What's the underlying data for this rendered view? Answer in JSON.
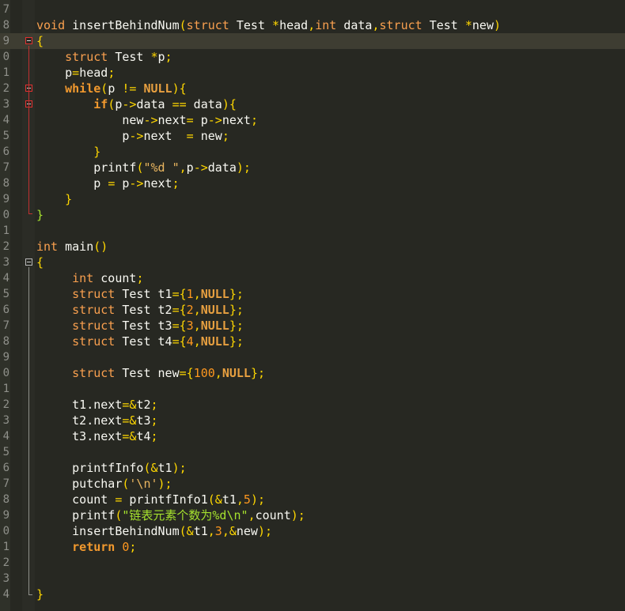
{
  "editor": {
    "theme_colors": {
      "background": "#272822",
      "current_line": "#3e3d32",
      "line_number": "#8f908a"
    },
    "lines": [
      {
        "num": "7",
        "segments": []
      },
      {
        "num": "8",
        "segments": [
          {
            "t": "void",
            "c": "kw"
          },
          {
            "t": " insertBehindNum",
            "c": "plain"
          },
          {
            "t": "(",
            "c": "br"
          },
          {
            "t": "struct",
            "c": "kw"
          },
          {
            "t": " Test ",
            "c": "plain"
          },
          {
            "t": "*",
            "c": "br"
          },
          {
            "t": "head",
            "c": "plain"
          },
          {
            "t": ",",
            "c": "br"
          },
          {
            "t": "int",
            "c": "kw"
          },
          {
            "t": " data",
            "c": "plain"
          },
          {
            "t": ",",
            "c": "br"
          },
          {
            "t": "struct",
            "c": "kw"
          },
          {
            "t": " Test ",
            "c": "plain"
          },
          {
            "t": "*",
            "c": "br"
          },
          {
            "t": "new",
            "c": "plain"
          },
          {
            "t": ")",
            "c": "br"
          }
        ]
      },
      {
        "num": "9",
        "current": true,
        "fold": "red",
        "segments": [
          {
            "t": "{",
            "c": "br"
          }
        ]
      },
      {
        "num": "0",
        "segments": [
          {
            "t": "    ",
            "c": "plain"
          },
          {
            "t": "struct",
            "c": "kw"
          },
          {
            "t": " Test ",
            "c": "plain"
          },
          {
            "t": "*",
            "c": "br"
          },
          {
            "t": "p",
            "c": "plain"
          },
          {
            "t": ";",
            "c": "br"
          }
        ]
      },
      {
        "num": "1",
        "segments": [
          {
            "t": "    p",
            "c": "plain"
          },
          {
            "t": "=",
            "c": "br"
          },
          {
            "t": "head",
            "c": "plain"
          },
          {
            "t": ";",
            "c": "br"
          }
        ]
      },
      {
        "num": "2",
        "fold": "red",
        "segments": [
          {
            "t": "    ",
            "c": "plain"
          },
          {
            "t": "while",
            "c": "kwb"
          },
          {
            "t": "(",
            "c": "br"
          },
          {
            "t": "p ",
            "c": "plain"
          },
          {
            "t": "!=",
            "c": "br"
          },
          {
            "t": " ",
            "c": "plain"
          },
          {
            "t": "NULL",
            "c": "lit"
          },
          {
            "t": "){",
            "c": "br"
          }
        ]
      },
      {
        "num": "3",
        "fold": "red",
        "segments": [
          {
            "t": "        ",
            "c": "plain"
          },
          {
            "t": "if",
            "c": "kwb"
          },
          {
            "t": "(",
            "c": "br"
          },
          {
            "t": "p",
            "c": "plain"
          },
          {
            "t": "->",
            "c": "br"
          },
          {
            "t": "data ",
            "c": "plain"
          },
          {
            "t": "==",
            "c": "br"
          },
          {
            "t": " data",
            "c": "plain"
          },
          {
            "t": "){",
            "c": "br"
          }
        ]
      },
      {
        "num": "4",
        "segments": [
          {
            "t": "            new",
            "c": "plain"
          },
          {
            "t": "->",
            "c": "br"
          },
          {
            "t": "next",
            "c": "plain"
          },
          {
            "t": "=",
            "c": "br"
          },
          {
            "t": " p",
            "c": "plain"
          },
          {
            "t": "->",
            "c": "br"
          },
          {
            "t": "next",
            "c": "plain"
          },
          {
            "t": ";",
            "c": "br"
          }
        ]
      },
      {
        "num": "5",
        "segments": [
          {
            "t": "            p",
            "c": "plain"
          },
          {
            "t": "->",
            "c": "br"
          },
          {
            "t": "next  ",
            "c": "plain"
          },
          {
            "t": "=",
            "c": "br"
          },
          {
            "t": " new",
            "c": "plain"
          },
          {
            "t": ";",
            "c": "br"
          }
        ]
      },
      {
        "num": "6",
        "segments": [
          {
            "t": "        ",
            "c": "plain"
          },
          {
            "t": "}",
            "c": "br"
          }
        ]
      },
      {
        "num": "7",
        "segments": [
          {
            "t": "        printf",
            "c": "plain"
          },
          {
            "t": "(",
            "c": "br"
          },
          {
            "t": "\"%d \"",
            "c": "st"
          },
          {
            "t": ",",
            "c": "br"
          },
          {
            "t": "p",
            "c": "plain"
          },
          {
            "t": "->",
            "c": "br"
          },
          {
            "t": "data",
            "c": "plain"
          },
          {
            "t": ");",
            "c": "br"
          }
        ]
      },
      {
        "num": "8",
        "segments": [
          {
            "t": "        p ",
            "c": "plain"
          },
          {
            "t": "=",
            "c": "br"
          },
          {
            "t": " p",
            "c": "plain"
          },
          {
            "t": "->",
            "c": "br"
          },
          {
            "t": "next",
            "c": "plain"
          },
          {
            "t": ";",
            "c": "br"
          }
        ]
      },
      {
        "num": "9",
        "segments": [
          {
            "t": "    ",
            "c": "plain"
          },
          {
            "t": "}",
            "c": "br"
          }
        ]
      },
      {
        "num": "0",
        "segments": [
          {
            "t": "}",
            "c": "strg"
          }
        ]
      },
      {
        "num": "1",
        "segments": []
      },
      {
        "num": "2",
        "segments": [
          {
            "t": "int",
            "c": "kw"
          },
          {
            "t": " main",
            "c": "plain"
          },
          {
            "t": "()",
            "c": "br"
          }
        ]
      },
      {
        "num": "3",
        "fold": "grey",
        "segments": [
          {
            "t": "{",
            "c": "br"
          }
        ]
      },
      {
        "num": "4",
        "segments": [
          {
            "t": "     ",
            "c": "plain"
          },
          {
            "t": "int",
            "c": "kw"
          },
          {
            "t": " count",
            "c": "plain"
          },
          {
            "t": ";",
            "c": "br"
          }
        ]
      },
      {
        "num": "5",
        "segments": [
          {
            "t": "     ",
            "c": "plain"
          },
          {
            "t": "struct",
            "c": "kw"
          },
          {
            "t": " Test t1",
            "c": "plain"
          },
          {
            "t": "={",
            "c": "br"
          },
          {
            "t": "1",
            "c": "num"
          },
          {
            "t": ",",
            "c": "br"
          },
          {
            "t": "NULL",
            "c": "lit"
          },
          {
            "t": "};",
            "c": "br"
          }
        ]
      },
      {
        "num": "6",
        "segments": [
          {
            "t": "     ",
            "c": "plain"
          },
          {
            "t": "struct",
            "c": "kw"
          },
          {
            "t": " Test t2",
            "c": "plain"
          },
          {
            "t": "={",
            "c": "br"
          },
          {
            "t": "2",
            "c": "num"
          },
          {
            "t": ",",
            "c": "br"
          },
          {
            "t": "NULL",
            "c": "lit"
          },
          {
            "t": "};",
            "c": "br"
          }
        ]
      },
      {
        "num": "7",
        "segments": [
          {
            "t": "     ",
            "c": "plain"
          },
          {
            "t": "struct",
            "c": "kw"
          },
          {
            "t": " Test t3",
            "c": "plain"
          },
          {
            "t": "={",
            "c": "br"
          },
          {
            "t": "3",
            "c": "num"
          },
          {
            "t": ",",
            "c": "br"
          },
          {
            "t": "NULL",
            "c": "lit"
          },
          {
            "t": "};",
            "c": "br"
          }
        ]
      },
      {
        "num": "8",
        "segments": [
          {
            "t": "     ",
            "c": "plain"
          },
          {
            "t": "struct",
            "c": "kw"
          },
          {
            "t": " Test t4",
            "c": "plain"
          },
          {
            "t": "={",
            "c": "br"
          },
          {
            "t": "4",
            "c": "num"
          },
          {
            "t": ",",
            "c": "br"
          },
          {
            "t": "NULL",
            "c": "lit"
          },
          {
            "t": "};",
            "c": "br"
          }
        ]
      },
      {
        "num": "9",
        "segments": []
      },
      {
        "num": "0",
        "segments": [
          {
            "t": "     ",
            "c": "plain"
          },
          {
            "t": "struct",
            "c": "kw"
          },
          {
            "t": " Test new",
            "c": "plain"
          },
          {
            "t": "={",
            "c": "br"
          },
          {
            "t": "100",
            "c": "num"
          },
          {
            "t": ",",
            "c": "br"
          },
          {
            "t": "NULL",
            "c": "lit"
          },
          {
            "t": "};",
            "c": "br"
          }
        ]
      },
      {
        "num": "1",
        "segments": []
      },
      {
        "num": "2",
        "segments": [
          {
            "t": "     t1.next",
            "c": "plain"
          },
          {
            "t": "=&",
            "c": "br"
          },
          {
            "t": "t2",
            "c": "plain"
          },
          {
            "t": ";",
            "c": "br"
          }
        ]
      },
      {
        "num": "3",
        "segments": [
          {
            "t": "     t2.next",
            "c": "plain"
          },
          {
            "t": "=&",
            "c": "br"
          },
          {
            "t": "t3",
            "c": "plain"
          },
          {
            "t": ";",
            "c": "br"
          }
        ]
      },
      {
        "num": "4",
        "segments": [
          {
            "t": "     t3.next",
            "c": "plain"
          },
          {
            "t": "=&",
            "c": "br"
          },
          {
            "t": "t4",
            "c": "plain"
          },
          {
            "t": ";",
            "c": "br"
          }
        ]
      },
      {
        "num": "5",
        "segments": []
      },
      {
        "num": "6",
        "segments": [
          {
            "t": "     printfInfo",
            "c": "plain"
          },
          {
            "t": "(&",
            "c": "br"
          },
          {
            "t": "t1",
            "c": "plain"
          },
          {
            "t": ");",
            "c": "br"
          }
        ]
      },
      {
        "num": "7",
        "segments": [
          {
            "t": "     putchar",
            "c": "plain"
          },
          {
            "t": "(",
            "c": "br"
          },
          {
            "t": "'\\n'",
            "c": "st"
          },
          {
            "t": ");",
            "c": "br"
          }
        ]
      },
      {
        "num": "8",
        "segments": [
          {
            "t": "     count ",
            "c": "plain"
          },
          {
            "t": "=",
            "c": "br"
          },
          {
            "t": " printfInfo1",
            "c": "plain"
          },
          {
            "t": "(&",
            "c": "br"
          },
          {
            "t": "t1",
            "c": "plain"
          },
          {
            "t": ",",
            "c": "br"
          },
          {
            "t": "5",
            "c": "num"
          },
          {
            "t": ");",
            "c": "br"
          }
        ]
      },
      {
        "num": "9",
        "segments": [
          {
            "t": "     printf",
            "c": "plain"
          },
          {
            "t": "(",
            "c": "br"
          },
          {
            "t": "\"链表元素个数为%d\\n\"",
            "c": "strg"
          },
          {
            "t": ",",
            "c": "br"
          },
          {
            "t": "count",
            "c": "plain"
          },
          {
            "t": ");",
            "c": "br"
          }
        ]
      },
      {
        "num": "0",
        "segments": [
          {
            "t": "     insertBehindNum",
            "c": "plain"
          },
          {
            "t": "(&",
            "c": "br"
          },
          {
            "t": "t1",
            "c": "plain"
          },
          {
            "t": ",",
            "c": "br"
          },
          {
            "t": "3",
            "c": "num"
          },
          {
            "t": ",&",
            "c": "br"
          },
          {
            "t": "new",
            "c": "plain"
          },
          {
            "t": ");",
            "c": "br"
          }
        ]
      },
      {
        "num": "1",
        "segments": [
          {
            "t": "     ",
            "c": "plain"
          },
          {
            "t": "return",
            "c": "kwb"
          },
          {
            "t": " ",
            "c": "plain"
          },
          {
            "t": "0",
            "c": "num"
          },
          {
            "t": ";",
            "c": "br"
          }
        ]
      },
      {
        "num": "2",
        "segments": []
      },
      {
        "num": "3",
        "segments": []
      },
      {
        "num": "4",
        "segments": [
          {
            "t": "}",
            "c": "br"
          }
        ]
      }
    ]
  }
}
